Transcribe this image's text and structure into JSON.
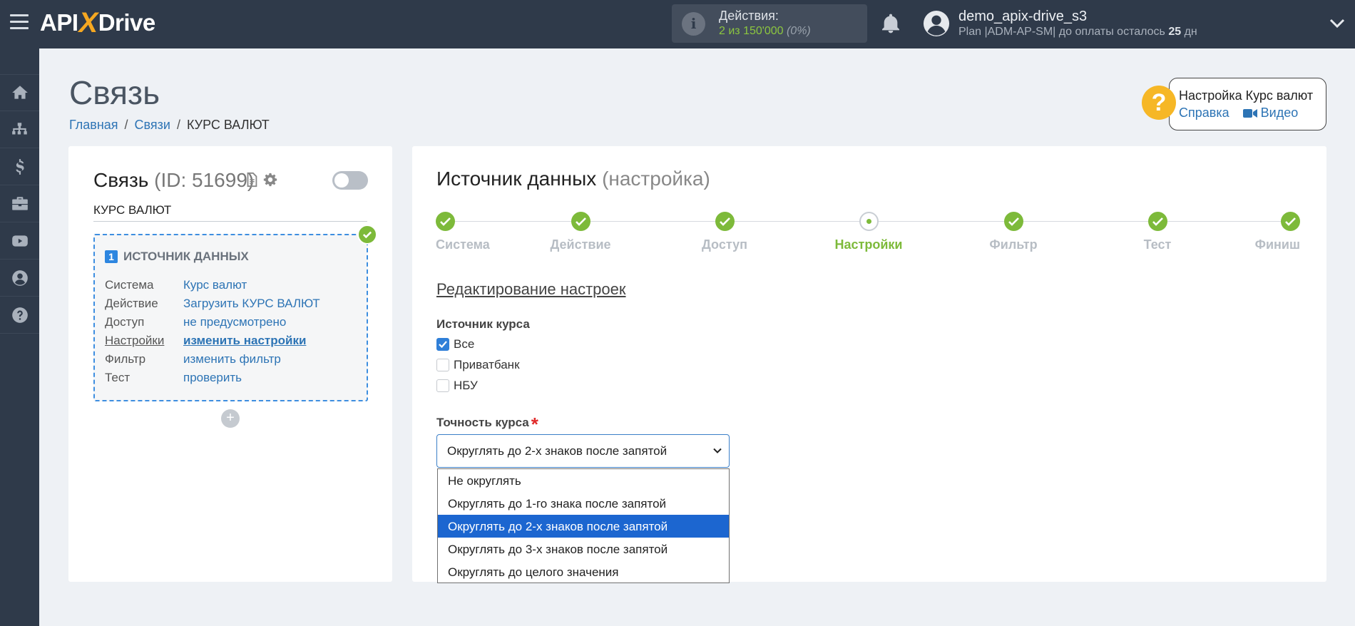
{
  "topbar": {
    "logo": {
      "part1": "API",
      "part2": "X",
      "part3": "Drive"
    },
    "actions": {
      "title": "Действия:",
      "value": "2 из 150'000",
      "percent": "(0%)"
    },
    "user": {
      "name": "demo_apix-drive_s3",
      "plan_prefix": "Plan |ADM-AP-SM| до оплаты осталось",
      "days": "25",
      "days_suffix": "дн"
    }
  },
  "sidebar": {
    "icons": [
      "home-icon",
      "sitemap-icon",
      "dollar-icon",
      "briefcase-icon",
      "youtube-icon",
      "user-circle-icon",
      "question-circle-icon"
    ]
  },
  "page": {
    "title": "Связь",
    "breadcrumb": {
      "home": "Главная",
      "connections": "Связи",
      "current": "КУРС ВАЛЮТ"
    }
  },
  "help": {
    "title": "Настройка Курс валют",
    "help_link": "Справка",
    "video_link": "Видео"
  },
  "connection": {
    "title": "Связь",
    "id_text": "(ID: 51699)",
    "name": "КУРС ВАЛЮТ",
    "source": {
      "number": "1",
      "heading": "ИСТОЧНИК ДАННЫХ",
      "rows": [
        {
          "key": "Система",
          "value": "Курс валют"
        },
        {
          "key": "Действие",
          "value": "Загрузить КУРС ВАЛЮТ"
        },
        {
          "key": "Доступ",
          "value": "не предусмотрено"
        },
        {
          "key": "Настройки",
          "value": "изменить настройки"
        },
        {
          "key": "Фильтр",
          "value": "изменить фильтр"
        },
        {
          "key": "Тест",
          "value": "проверить"
        }
      ]
    },
    "add_label": "+"
  },
  "settings": {
    "title": "Источник данных",
    "subtitle": "(настройка)",
    "steps": [
      "Система",
      "Действие",
      "Доступ",
      "Настройки",
      "Фильтр",
      "Тест",
      "Финиш"
    ],
    "current_step": "Настройки",
    "edit_title": "Редактирование настроек",
    "source_label": "Источник курса",
    "checkboxes": [
      {
        "label": "Все",
        "checked": true
      },
      {
        "label": "Приватбанк",
        "checked": false
      },
      {
        "label": "НБУ",
        "checked": false
      }
    ],
    "precision_label": "Точность курса",
    "required_mark": "*",
    "selected": "Округлять до 2-х знаков после запятой",
    "options": [
      "Не округлять",
      "Округлять до 1-го знака после запятой",
      "Округлять до 2-х знаков после запятой",
      "Округлять до 3-х знаков после запятой",
      "Округлять до целого значения"
    ]
  },
  "colors": {
    "topbar": "#2f3a4a",
    "accent_green": "#7dba3a",
    "link_blue": "#2d74b5",
    "select_blue": "#1c66d0",
    "help_yellow": "#f6b726"
  }
}
